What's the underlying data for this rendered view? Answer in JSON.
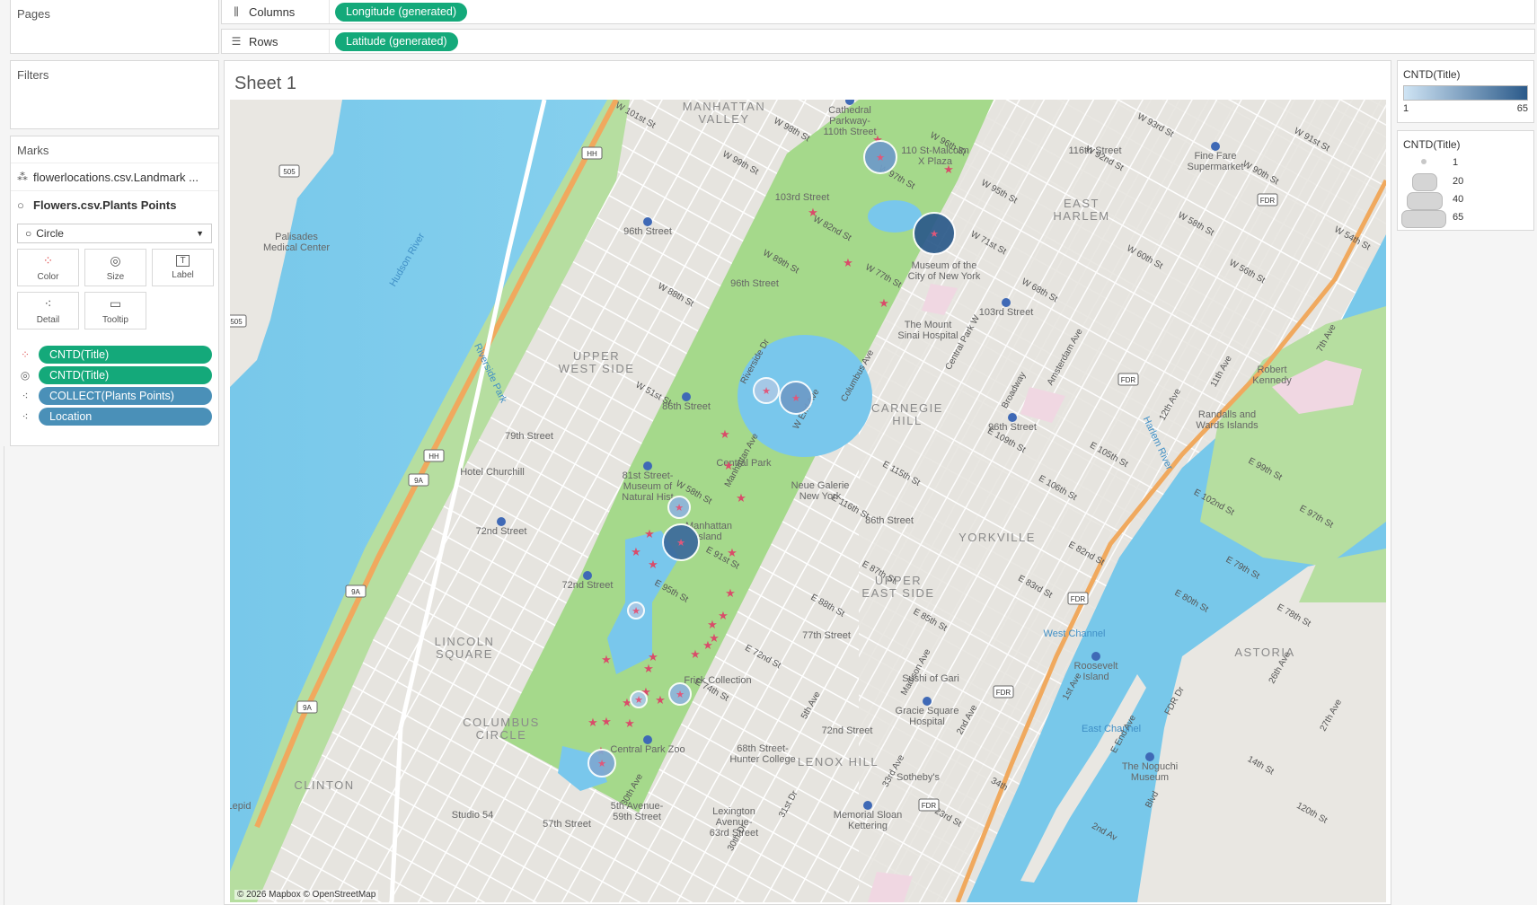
{
  "pages": {
    "title": "Pages"
  },
  "shelves": {
    "columns": {
      "label": "Columns",
      "icon": "columns-icon",
      "pill": "Longitude (generated)"
    },
    "rows": {
      "label": "Rows",
      "icon": "rows-icon",
      "pill": "Latitude (generated)"
    }
  },
  "filters": {
    "title": "Filters"
  },
  "marks": {
    "title": "Marks",
    "sources": [
      {
        "label": "flowerlocations.csv.Landmark ...",
        "icon": "multi-layer-icon"
      },
      {
        "label": "Flowers.csv.Plants Points",
        "icon": "circle-layer-icon"
      }
    ],
    "mark_type": "Circle",
    "buttons": [
      "Color",
      "Size",
      "Label",
      "Detail",
      "Tooltip"
    ],
    "pills": [
      {
        "icon": "color-icon",
        "label": "CNTD(Title)",
        "color": "#14a97a"
      },
      {
        "icon": "size-icon",
        "label": "CNTD(Title)",
        "color": "#14a97a"
      },
      {
        "icon": "detail-icon",
        "label": "COLLECT(Plants Points)",
        "color": "#4a90b8"
      },
      {
        "icon": "detail-icon",
        "label": "Location",
        "color": "#4a90b8"
      }
    ]
  },
  "sheet": {
    "title": "Sheet 1"
  },
  "legends": {
    "color": {
      "title": "CNTD(Title)",
      "min": "1",
      "max": "65",
      "from": "#cfe4f4",
      "to": "#2b5a8a"
    },
    "size": {
      "title": "CNTD(Title)",
      "items": [
        "1",
        "20",
        "40",
        "65"
      ]
    }
  },
  "map": {
    "attribution": "© 2026 Mapbox © OpenStreetMap",
    "neighborhoods": [
      "MANHATTAN\nVALLEY",
      "UPPER\nWEST SIDE",
      "CARNEGIE\nHILL",
      "EAST\nHARLEM",
      "YORKVILLE",
      "UPPER\nEAST SIDE",
      "LINCOLN\nSQUARE",
      "COLUMBUS\nCIRCLE",
      "LENOX HILL",
      "CLINTON",
      "ASTORIA"
    ],
    "places": [
      "Cathedral\nParkway-\n110th Street",
      "110 St-Malcolm\nX Plaza",
      "116th Street",
      "Fine Fare\nSupermarket",
      "103rd Street",
      "Palisades\nMedical Center",
      "96th Street",
      "96th Street",
      "Museum of the\nCity of New York",
      "103rd Street",
      "The Mount\nSinai Hospital",
      "Riverside Park",
      "86th Street",
      "79th Street",
      "Hotel Churchill",
      "81st Street-\nMuseum of\nNatural Hist",
      "Central Park",
      "Neue Galerie\nNew York",
      "96th Street",
      "Randalls and\nWards Islands",
      "Robert\nKennedy",
      "72nd Street",
      "86th Street",
      "Manhattan\nIsland",
      "72nd Street",
      "77th Street",
      "West Channel",
      "Roosevelt\nIsland",
      "Frick Collection",
      "Sushi of Gari",
      "Gracie Square\nHospital",
      "72nd Street",
      "East Channel",
      "Central Park Zoo",
      "68th Street-\nHunter College",
      "Sotheby's",
      "The Noguchi\nMuseum",
      "5th Avenue-\n59th Street",
      "Lexington\nAvenue-\n63rd Street",
      "Memorial Sloan\nKettering",
      "57th Street",
      "Studio 54",
      "Hudson River",
      "Harlem River",
      "Lepid"
    ],
    "streets": [
      "W 101st St",
      "W 99th St",
      "W 98th St",
      "W 97th St",
      "W 96th St",
      "W 95th St",
      "W 92nd St",
      "W 93rd St",
      "W 90th St",
      "W 91st St",
      "W 88th St",
      "W 89th St",
      "W 82nd St",
      "W 77th St",
      "W 71st St",
      "W 68th St",
      "W 60th St",
      "W 58th St",
      "W 56th St",
      "W 54th St",
      "W 51st St",
      "Riverside Dr",
      "W End Ave",
      "Columbus Ave",
      "Central Park W",
      "Broadway",
      "Amsterdam Ave",
      "12th Ave",
      "11th Ave",
      "7th Ave",
      "W 58th St",
      "Manhattan Ave",
      "E 116th St",
      "E 115th St",
      "E 109th St",
      "E 106th St",
      "E 105th St",
      "E 102nd St",
      "E 99th St",
      "E 97th St",
      "E 95th St",
      "E 91st St",
      "E 88th St",
      "E 87th St",
      "E 85th St",
      "E 83rd St",
      "E 82nd St",
      "E 80th St",
      "E 79th St",
      "E 78th St",
      "E 74th St",
      "E 72nd St",
      "5th Ave",
      "Madison Ave",
      "2nd Ave",
      "1st Ave",
      "E End Ave",
      "FDR Dr",
      "26th Ave",
      "27th Ave",
      "30th Ave",
      "30th Dr",
      "31st Dr",
      "33rd Ave",
      "23rd St",
      "34th",
      "2nd Av",
      "Blvd",
      "14th St",
      "120th St"
    ],
    "shields": [
      "HH",
      "505",
      "505",
      "HH",
      "9A",
      "9A",
      "9A",
      "FDR",
      "FDR",
      "FDR",
      "FDR",
      "FDR"
    ]
  }
}
